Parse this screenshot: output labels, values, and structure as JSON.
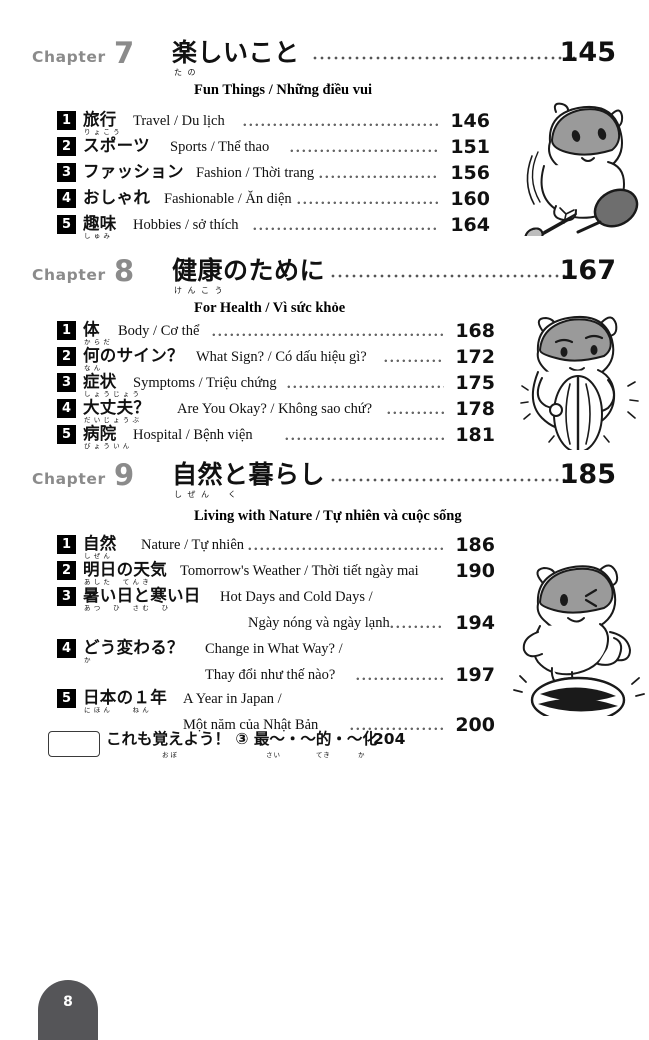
{
  "page": {
    "folio": "8",
    "chapter_label": "Chapter"
  },
  "chapters": [
    {
      "number": "7",
      "title_jp": "楽しいこと",
      "title_furigana": "たの",
      "page": "145",
      "subtitle": "Fun Things / Những điều vui",
      "illustration": "hamster-playing-tennis",
      "sections": [
        {
          "num": "1",
          "jp": "旅行",
          "furigana": "りょこう",
          "translation": "Travel / Du lịch",
          "page": "146"
        },
        {
          "num": "2",
          "jp": "スポーツ",
          "furigana": "",
          "translation": "Sports / Thể thao",
          "page": "151"
        },
        {
          "num": "3",
          "jp": "ファッション",
          "furigana": "",
          "translation": "Fashion / Thời trang",
          "page": "156"
        },
        {
          "num": "4",
          "jp": "おしゃれ",
          "furigana": "",
          "translation": "Fashionable / Ăn diện",
          "page": "160"
        },
        {
          "num": "5",
          "jp": "趣味",
          "furigana": "しゅみ",
          "translation": "Hobbies / sở thích",
          "page": "164"
        }
      ]
    },
    {
      "number": "8",
      "title_jp": "健康のために",
      "title_furigana": "けんこう",
      "page": "167",
      "subtitle": "For Health / Vì sức khỏe",
      "illustration": "hamster-feeling-sick",
      "sections": [
        {
          "num": "1",
          "jp": "体",
          "furigana": "からだ",
          "translation": "Body / Cơ thể",
          "page": "168"
        },
        {
          "num": "2",
          "jp": "何のサイン？",
          "furigana": "なん",
          "translation": "What Sign? / Có dấu hiệu gì?",
          "page": "172"
        },
        {
          "num": "3",
          "jp": "症状",
          "furigana": "しょうじょう",
          "translation": "Symptoms / Triệu chứng",
          "page": "175"
        },
        {
          "num": "4",
          "jp": "大丈夫？",
          "furigana": "だいじょうぶ",
          "translation": "Are You Okay? / Không sao chứ?",
          "page": "178"
        },
        {
          "num": "5",
          "jp": "病院",
          "furigana": "びょういん",
          "translation": "Hospital / Bệnh viện",
          "page": "181"
        }
      ]
    },
    {
      "number": "9",
      "title_jp": "自然と暮らし",
      "title_furigana": "しぜん　く",
      "page": "185",
      "subtitle": "Living with Nature / Tự nhiên và cuộc sống",
      "illustration": "hamster-balancing-on-seed",
      "sections": [
        {
          "num": "1",
          "jp": "自然",
          "furigana": "しぜん",
          "translation": "Nature / Tự nhiên",
          "page": "186"
        },
        {
          "num": "2",
          "jp": "明日の天気",
          "furigana": "あした　てんき",
          "translation": "Tomorrow's Weather / Thời tiết ngày mai",
          "page": "190"
        },
        {
          "num": "3",
          "jp": "暑い日と寒い日",
          "furigana": "あつ　ひ　さむ　ひ",
          "translation": "Hot Days and Cold Days /",
          "translation2": "Ngày nóng và ngày lạnh",
          "page": "194"
        },
        {
          "num": "4",
          "jp": "どう変わる？",
          "furigana": "か",
          "translation": "Change in What Way? /",
          "translation2": "Thay đổi như thế nào?",
          "page": "197"
        },
        {
          "num": "5",
          "jp": "日本の１年",
          "furigana": "にほん　　ねん",
          "translation": "A Year in Japan /",
          "translation2": "Một năm của Nhật Bản",
          "page": "200"
        }
      ]
    }
  ],
  "extra_entry": {
    "label": "これも覚えよう！ ③ 最〜・〜的・〜化",
    "furigana_oboe": "おぼ",
    "furigana_sai": "さい",
    "furigana_teki": "てき",
    "furigana_ka": "か",
    "page": "204"
  }
}
